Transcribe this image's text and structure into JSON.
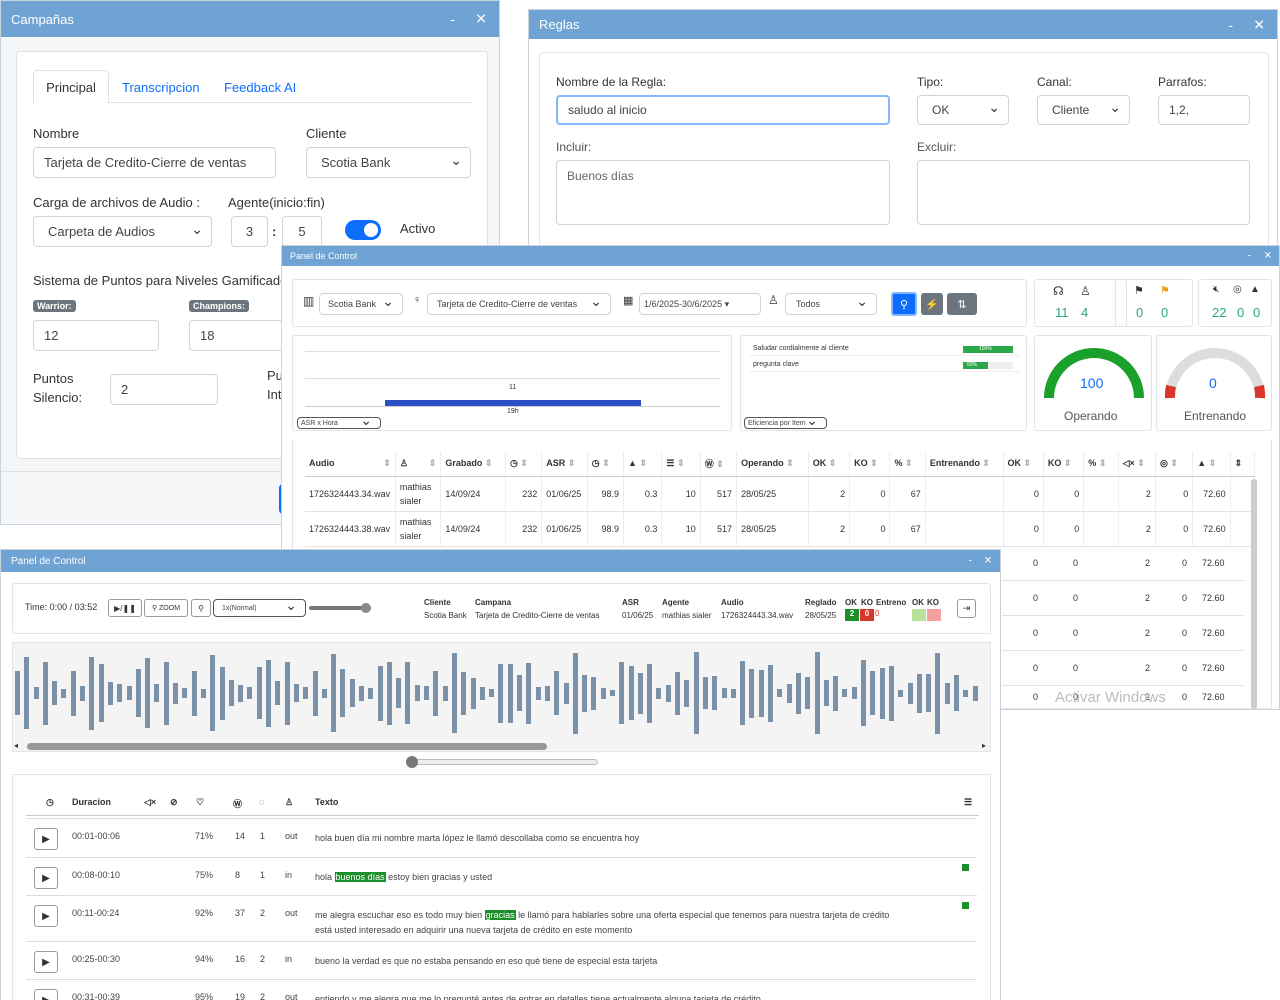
{
  "campanas": {
    "title": "Campañas",
    "minimize": "-",
    "close": "✕",
    "tabs": [
      "Principal",
      "Transcripcion",
      "Feedback AI"
    ],
    "nombre_label": "Nombre",
    "nombre_value": "Tarjeta de Credito-Cierre de ventas",
    "cliente_label": "Cliente",
    "cliente_value": "Scotia Bank",
    "carga_label": "Carga de archivos de Audio :",
    "carga_value": "Carpeta de Audios",
    "agente_label": "Agente(inicio:fin)",
    "agente_start": "3",
    "agente_sep": ":",
    "agente_end": "5",
    "activo_label": "Activo",
    "puntos_label": "Sistema de Puntos para Niveles Gamificados",
    "warrior_label": "Warrior:",
    "warrior_value": "12",
    "champions_label": "Champions:",
    "champions_value": "18",
    "silencio_label1": "Puntos",
    "silencio_label2": "Silencio:",
    "silencio_value": "2",
    "cut1": "Pu",
    "cut2": "Int"
  },
  "reglas": {
    "title": "Reglas",
    "minimize": "-",
    "close": "✕",
    "nombre_label": "Nombre de la Regla:",
    "nombre_value": "saludo al inicio",
    "tipo_label": "Tipo:",
    "tipo_value": "OK",
    "canal_label": "Canal:",
    "canal_value": "Cliente",
    "parrafos_label": "Parrafos:",
    "parrafos_value": "1,2,",
    "incluir_label": "Incluir:",
    "incluir_value": "Buenos días",
    "excluir_label": "Excluir:"
  },
  "panel1": {
    "title": "Panel de Control",
    "minimize": "-",
    "close": "✕",
    "cliente": "Scotia Bank",
    "campana": "Tarjeta de Credito-Cierre de ventas",
    "fecha": "1/6/2025-30/6/2025 ▾",
    "todos": "Todos",
    "stats": {
      "a": "11",
      "b": "4",
      "c": "0",
      "d": "0",
      "e": "22",
      "f": "0",
      "g": "0"
    },
    "chart_select": "ASR x Hora",
    "chart_value": "11",
    "chart_x": "19h",
    "items_select": "Eficiencia por Item",
    "items": [
      {
        "label": "Saludar cordialmente al cliente",
        "pct": "100%",
        "frac": 1.0
      },
      {
        "label": "pregunta clave",
        "pct": "50%",
        "frac": 0.5
      }
    ],
    "gauge1": {
      "value": "100",
      "label": "Operando"
    },
    "gauge2": {
      "value": "0",
      "label": "Entrenando"
    },
    "headers": [
      "Audio",
      "",
      "Grabado",
      "",
      "ASR",
      "",
      "",
      "",
      "",
      "Operando",
      "OK",
      "KO",
      "%",
      "Entrenando",
      "OK",
      "KO",
      "%",
      "",
      "",
      "",
      ""
    ],
    "rows": [
      {
        "audio": "1726324443.34.wav",
        "agente": "mathias sialer",
        "grabado": "14/09/24",
        "c1": "232",
        "asr": "01/06/25",
        "c2": "98.9",
        "c3": "0.3",
        "c4": "10",
        "c5": "517",
        "op": "28/05/25",
        "ok": "2",
        "ko": "0",
        "pct": "67",
        "tok": "0",
        "tko": "0",
        "s1": "2",
        "s2": "0",
        "s3": "72.60"
      },
      {
        "audio": "1726324443.38.wav",
        "agente": "mathias sialer",
        "grabado": "14/09/24",
        "c1": "232",
        "asr": "01/06/25",
        "c2": "98.9",
        "c3": "0.3",
        "c4": "10",
        "c5": "517",
        "op": "28/05/25",
        "ok": "2",
        "ko": "0",
        "pct": "67",
        "tok": "0",
        "tko": "0",
        "s1": "2",
        "s2": "0",
        "s3": "72.60"
      }
    ],
    "extra_rows": [
      {
        "tok": "0",
        "tko": "0",
        "s1": "2",
        "s2": "0",
        "s3": "72.60"
      },
      {
        "tok": "0",
        "tko": "0",
        "s1": "2",
        "s2": "0",
        "s3": "72.60"
      },
      {
        "tok": "0",
        "tko": "0",
        "s1": "2",
        "s2": "0",
        "s3": "72.60"
      },
      {
        "tok": "0",
        "tko": "0",
        "s1": "2",
        "s2": "0",
        "s3": "72.60"
      },
      {
        "tok": "0",
        "tko": "0",
        "s1": "2",
        "s2": "0",
        "s3": "72.60"
      }
    ],
    "watermark": "Activar Windows"
  },
  "panel2": {
    "title": "Panel de Control",
    "minimize": "-",
    "close": "✕",
    "time": "Time: 0:00 / 03:52",
    "zoom": "ZOOM",
    "speed": "1x(Normal)",
    "info": {
      "cliente_h": "Cliente",
      "cliente_v": "Scotia Bank",
      "campana_h": "Campana",
      "campana_v": "Tarjeta de Credito-Cierre de ventas",
      "asr_h": "ASR",
      "asr_v": "01/06/25",
      "agente_h": "Agente",
      "agente_v": "mathias sialer",
      "audio_h": "Audio",
      "audio_v": "1726324443.34.wav",
      "reglado_h": "Reglado",
      "reglado_v": "28/05/25",
      "ok_h": "OK",
      "ko_h": "KO",
      "entreno_h": "Entreno",
      "ok2_h": "OK",
      "ko2_h": "KO",
      "ok_v": "2",
      "ko_v": "0",
      "entreno_v": "0"
    },
    "th": {
      "duracion": "Duracion",
      "texto": "Texto"
    },
    "rows": [
      {
        "dur": "00:01-00:06",
        "pct": "71%",
        "n1": "14",
        "n2": "1",
        "dir": "out",
        "pre": "hola buen día mi nombre marta lópez le llamó descollaba como se encuentra hoy",
        "hl": "",
        "post": "",
        "line2": ""
      },
      {
        "dur": "00:08-00:10",
        "pct": "75%",
        "n1": "8",
        "n2": "1",
        "dir": "in",
        "pre": "hola ",
        "hl": "buenos días",
        "post": " estoy bien gracias y usted",
        "line2": ""
      },
      {
        "dur": "00:11-00:24",
        "pct": "92%",
        "n1": "37",
        "n2": "2",
        "dir": "out",
        "pre": "me alegra escuchar eso es todo muy bien ",
        "hl": "gracias",
        "post": " le llamó para hablarles sobre una oferta especial que tenemos para nuestra tarjeta de crédito",
        "line2": "está usted interesado en adquirir una nueva tarjeta de crédito en este momento"
      },
      {
        "dur": "00:25-00:30",
        "pct": "94%",
        "n1": "16",
        "n2": "2",
        "dir": "in",
        "pre": "bueno la verdad es que no estaba pensando en eso qué tiene de especial esta tarjeta",
        "hl": "",
        "post": "",
        "line2": ""
      },
      {
        "dur": "00:31-00:39",
        "pct": "95%",
        "n1": "19",
        "n2": "2",
        "dir": "out",
        "pre": "entiendo y me alegra que me lo pregunté antes de entrar en detalles tiene actualmente alguna tarjeta de crédito",
        "hl": "",
        "post": "",
        "line2": ""
      }
    ]
  },
  "colors": {
    "titlebar": "#6fa3d3",
    "primary": "#0d6efd",
    "green": "#1a8f2a",
    "red": "#d9362b",
    "waveform": "#7b91a8"
  }
}
